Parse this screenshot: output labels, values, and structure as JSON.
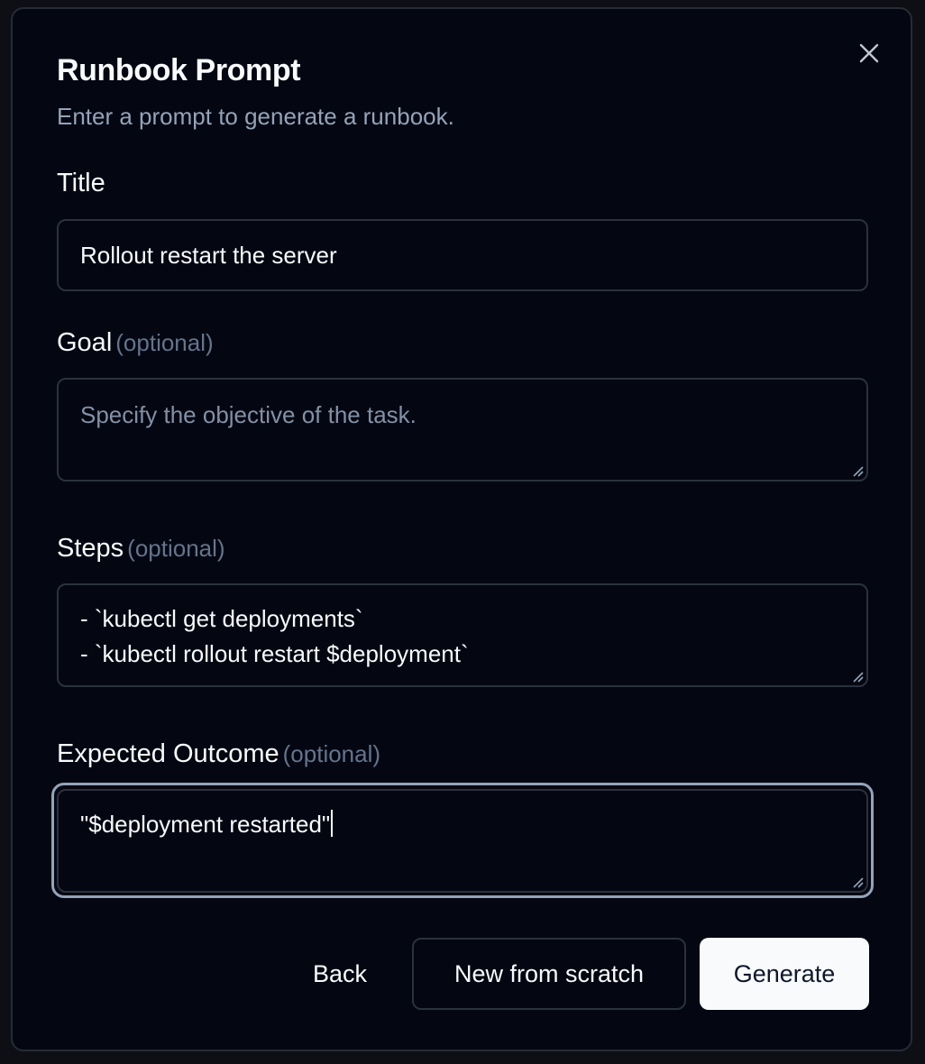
{
  "dialog": {
    "title": "Runbook Prompt",
    "subtitle": "Enter a prompt to generate a runbook.",
    "close_icon": "close-icon"
  },
  "fields": {
    "title": {
      "label": "Title",
      "value": "Rollout restart the server"
    },
    "goal": {
      "label": "Goal",
      "optional": "(optional)",
      "value": "",
      "placeholder": "Specify the objective of the task."
    },
    "steps": {
      "label": "Steps",
      "optional": "(optional)",
      "lines": [
        "- `kubectl get deployments`",
        "- `kubectl rollout restart $deployment`"
      ]
    },
    "expected_outcome": {
      "label": "Expected Outcome",
      "optional": "(optional)",
      "value": "\"$deployment restarted\"",
      "focused": true
    }
  },
  "actions": {
    "back": "Back",
    "new_from_scratch": "New from scratch",
    "generate": "Generate"
  },
  "colors": {
    "background": "#040712",
    "border": "#2b313d",
    "text": "#f8fafc",
    "muted": "#94a3b8",
    "primary_button_bg": "#f8fafc",
    "primary_button_text": "#0f172a",
    "focus_ring": "#94a3b8"
  }
}
